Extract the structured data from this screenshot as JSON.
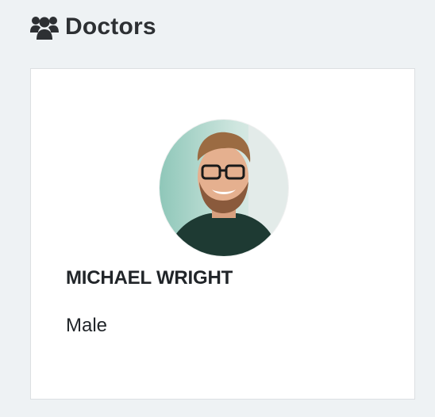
{
  "header": {
    "title": "Doctors",
    "icon": "users-icon"
  },
  "doctor": {
    "name": "MICHAEL WRIGHT",
    "gender": "Male",
    "avatar": "doctor-photo"
  }
}
